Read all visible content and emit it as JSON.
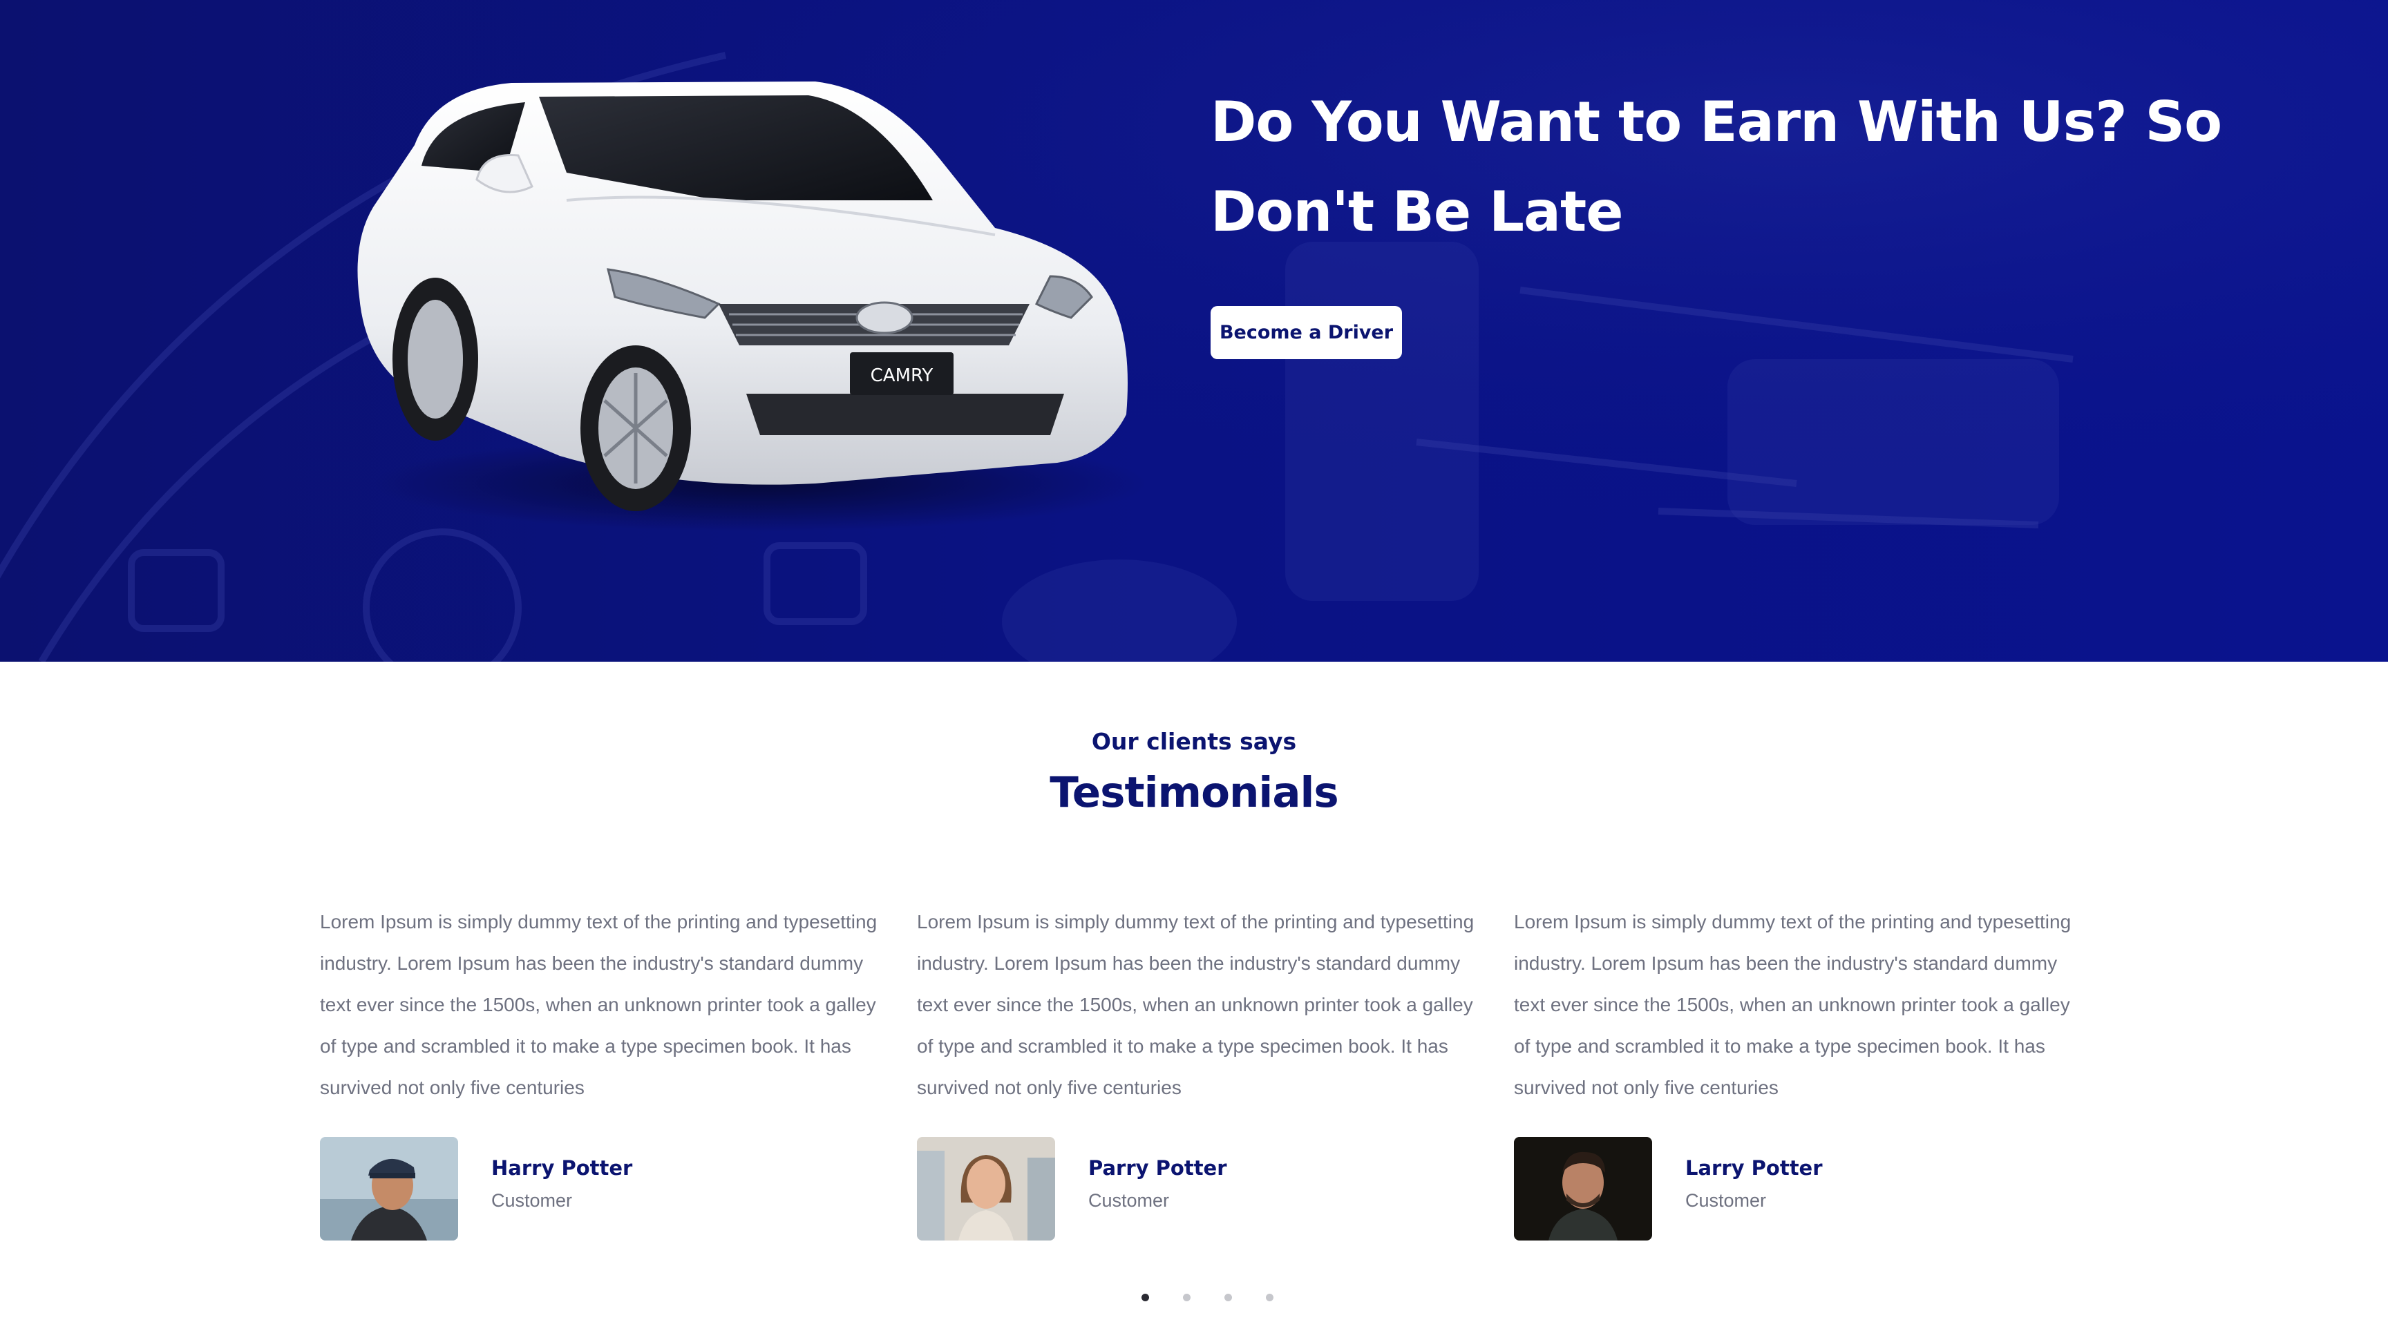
{
  "hero": {
    "title_line1": "Do You Want to Earn With Us? So",
    "title_line2": "Don't Be Late",
    "button_label": "Become a Driver",
    "car_plate": "CAMRY",
    "background_color": "#0a1283"
  },
  "testimonials": {
    "eyebrow": "Our clients says",
    "title": "Testimonials",
    "items": [
      {
        "text": "Lorem Ipsum is simply dummy text of the printing and typesetting industry. Lorem Ipsum has been the industry's standard dummy text ever since the 1500s, when an unknown printer took a galley of type and scrambled it to make a type specimen book. It has survived not only five centuries",
        "name": "Harry Potter",
        "role": "Customer"
      },
      {
        "text": "Lorem Ipsum is simply dummy text of the printing and typesetting industry. Lorem Ipsum has been the industry's standard dummy text ever since the 1500s, when an unknown printer took a galley of type and scrambled it to make a type specimen book. It has survived not only five centuries",
        "name": "Parry Potter",
        "role": "Customer"
      },
      {
        "text": "Lorem Ipsum is simply dummy text of the printing and typesetting industry. Lorem Ipsum has been the industry's standard dummy text ever since the 1500s, when an unknown printer took a galley of type and scrambled it to make a type specimen book. It has survived not only five centuries",
        "name": "Larry Potter",
        "role": "Customer"
      }
    ],
    "pagination": {
      "total": 4,
      "active": 1
    }
  },
  "colors": {
    "brand_navy": "#0b1470",
    "body_text": "#6e7180",
    "dot_inactive": "#c6c7cc",
    "dot_active": "#2b2b33"
  }
}
